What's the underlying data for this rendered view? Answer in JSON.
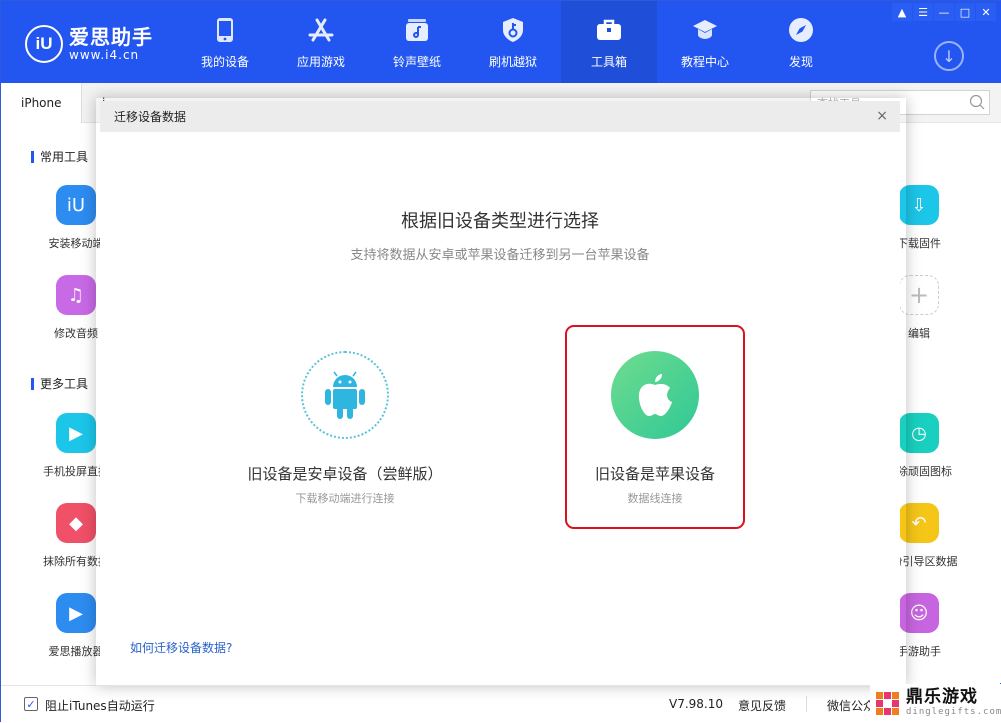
{
  "app": {
    "name": "爱思助手",
    "url": "www.i4.cn",
    "logo_mark": "iU"
  },
  "nav": {
    "items": [
      {
        "label": "我的设备",
        "icon": "phone-icon"
      },
      {
        "label": "应用游戏",
        "icon": "app-store-icon"
      },
      {
        "label": "铃声壁纸",
        "icon": "music-icon"
      },
      {
        "label": "刷机越狱",
        "icon": "shield-key-icon"
      },
      {
        "label": "工具箱",
        "icon": "toolbox-icon",
        "active": true
      },
      {
        "label": "教程中心",
        "icon": "graduation-cap-icon"
      },
      {
        "label": "发现",
        "icon": "compass-icon"
      }
    ],
    "window_controls": [
      "shirt-icon",
      "menu-icon",
      "minimize-icon",
      "maximize-icon",
      "close-icon"
    ]
  },
  "tabs": {
    "active": "iPhone",
    "second": "i"
  },
  "search": {
    "placeholder": "查找工具"
  },
  "sections": {
    "common": "常用工具",
    "more": "更多工具"
  },
  "tools_left": [
    {
      "label": "安装移动端",
      "color": "#2d8cf0",
      "icon": "iu-icon"
    },
    {
      "label": "修改音频",
      "color": "#c869e6",
      "icon": "audio-file-icon"
    },
    {
      "label": "手机投屏直播",
      "color": "#1cc6e8",
      "icon": "screen-cast-icon"
    },
    {
      "label": "抹除所有数据",
      "color": "#f05068",
      "icon": "eraser-icon"
    },
    {
      "label": "爱思播放器",
      "color": "#2d8cf0",
      "icon": "play-icon"
    }
  ],
  "tools_right": [
    {
      "label": "下载固件",
      "color": "#1cc6e8",
      "icon": "download-firmware-icon"
    },
    {
      "label": "编辑",
      "color": "#ffffff",
      "icon": "plus-icon"
    },
    {
      "label": "删除顽固图标",
      "color": "#19d0c0",
      "icon": "clock-icon"
    },
    {
      "label": "备份引导区数据",
      "color": "#f5c518",
      "icon": "drive-backup-icon"
    },
    {
      "label": "手游助手",
      "color": "#c765e0",
      "icon": "game-helper-icon"
    }
  ],
  "dialog": {
    "title": "迁移设备数据",
    "heading": "根据旧设备类型进行选择",
    "subheading": "支持将数据从安卓或苹果设备迁移到另一台苹果设备",
    "options": [
      {
        "label": "旧设备是安卓设备（尝鲜版）",
        "sub": "下载移动端进行连接",
        "icon": "android-icon"
      },
      {
        "label": "旧设备是苹果设备",
        "sub": "数据线连接",
        "icon": "apple-icon",
        "highlighted": true
      }
    ],
    "help_link": "如何迁移设备数据?",
    "close": "×"
  },
  "footer": {
    "checkbox_label": "阻止iTunes自动运行",
    "checkbox_checked": true,
    "version": "V7.98.10",
    "feedback": "意见反馈",
    "wechat": "微信公众号"
  },
  "watermark": {
    "title": "鼎乐游戏",
    "url": "dinglegifts.com"
  }
}
